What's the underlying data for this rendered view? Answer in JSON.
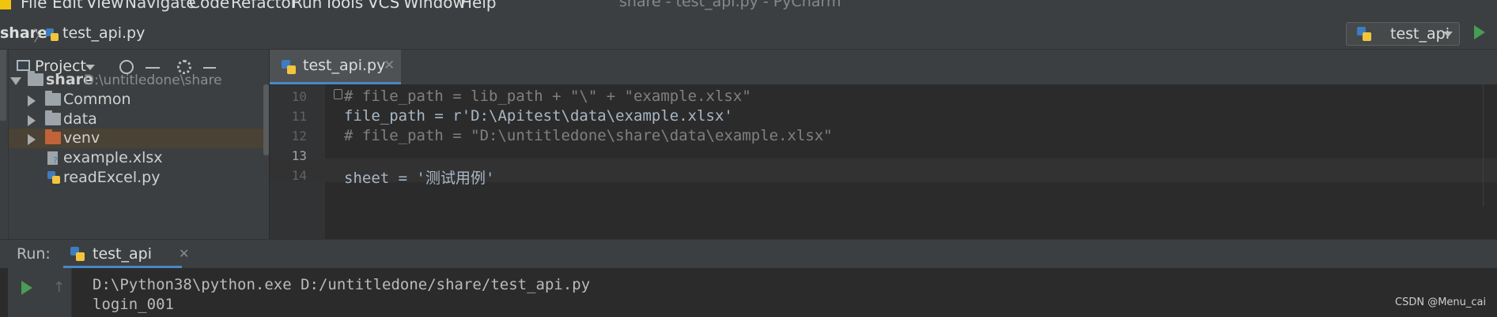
{
  "menubar": {
    "items": [
      "File",
      "Edit",
      "View",
      "Navigate",
      "Code",
      "Refactor",
      "Run",
      "Tools",
      "VCS",
      "Window",
      "Help"
    ],
    "window_title": "share - test_api.py - PyCharm"
  },
  "navbar": {
    "breadcrumb_root": "share",
    "breadcrumb_file": "test_api.py",
    "run_config": "test_api"
  },
  "project_panel": {
    "title": "Project",
    "root": {
      "name": "share",
      "path": "D:\\untitledone\\share"
    },
    "items": [
      {
        "label": "Common",
        "type": "folder"
      },
      {
        "label": "data",
        "type": "folder"
      },
      {
        "label": "venv",
        "type": "folder-excluded"
      },
      {
        "label": "example.xlsx",
        "type": "file-xlsx"
      },
      {
        "label": "readExcel.py",
        "type": "file-py"
      }
    ]
  },
  "editor": {
    "tab_label": "test_api.py",
    "lines": [
      {
        "num": "10",
        "text": "# file_path = lib_path + \"\\\" + \"example.xlsx\""
      },
      {
        "num": "11",
        "text": "file_path = r'D:\\Apitest\\data\\example.xlsx'"
      },
      {
        "num": "12",
        "text": "# file_path = \"D:\\untitledone\\share\\data\\example.xlsx\""
      },
      {
        "num": "13",
        "text": ""
      },
      {
        "num": "14",
        "text": "sheet = '测试用例'"
      }
    ]
  },
  "run_panel": {
    "title": "Run:",
    "tab_label": "test_api",
    "output": [
      "D:\\Python38\\python.exe D:/untitledone/share/test_api.py",
      "login_001"
    ]
  },
  "watermark": "CSDN @Menu_cai",
  "colors": {
    "background": "#2b2b2b",
    "panel": "#3c3f41",
    "accent": "#4a88c7",
    "run_green": "#499c54",
    "string_green": "#6a8759",
    "comment_gray": "#808080"
  }
}
